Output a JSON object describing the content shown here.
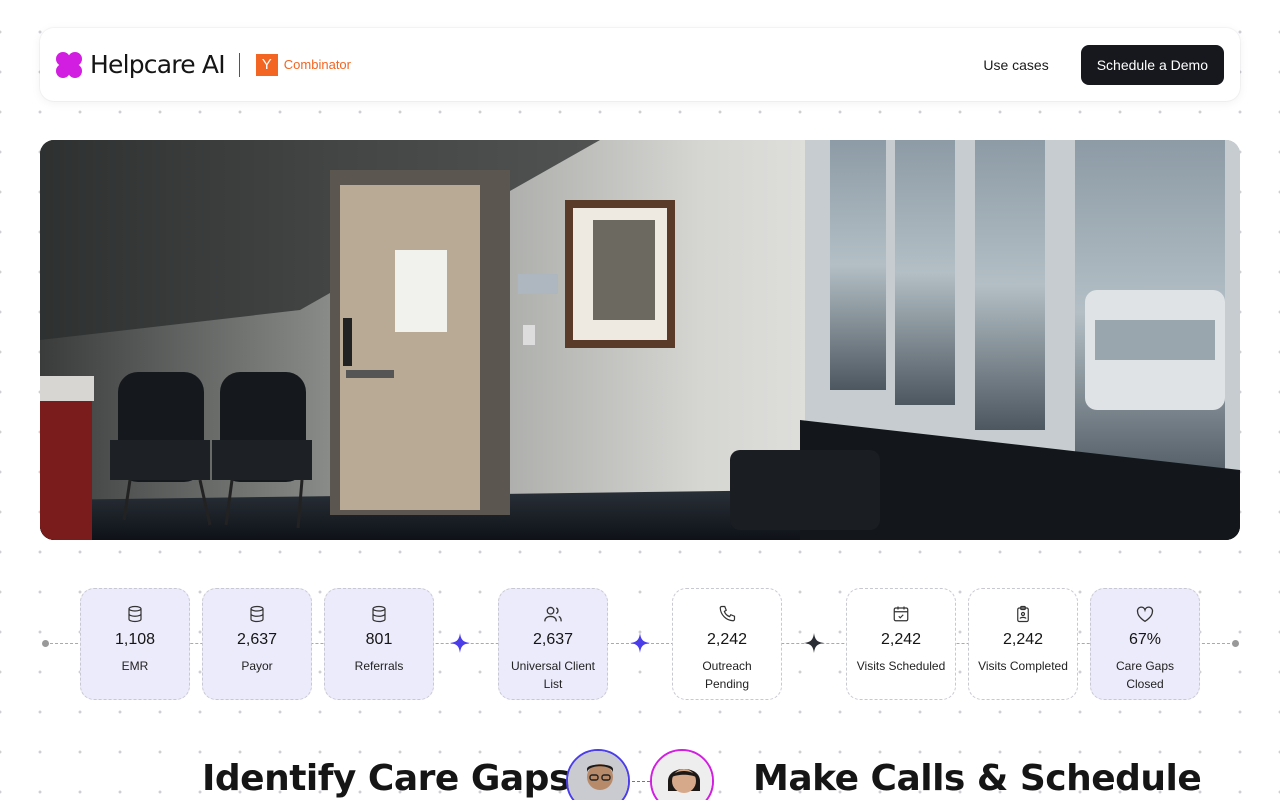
{
  "nav": {
    "brand": "Helpcare AI",
    "yc_letter": "Y",
    "yc_text": "Combinator",
    "link_use_cases": "Use cases",
    "cta": "Schedule a Demo"
  },
  "flow": [
    {
      "icon": "database-icon",
      "value": "1,108",
      "label": "EMR",
      "style": "filled"
    },
    {
      "icon": "database-icon",
      "value": "2,637",
      "label": "Payor",
      "style": "filled"
    },
    {
      "icon": "database-icon",
      "value": "801",
      "label": "Referrals",
      "style": "filled"
    },
    {
      "icon": "users-icon",
      "value": "2,637",
      "label": "Universal Client List",
      "style": "filled"
    },
    {
      "icon": "phone-icon",
      "value": "2,242",
      "label": "Outreach Pending",
      "style": "plain"
    },
    {
      "icon": "calendar-check-icon",
      "value": "2,242",
      "label": "Visits Scheduled",
      "style": "plain"
    },
    {
      "icon": "clipboard-icon",
      "value": "2,242",
      "label": "Visits Completed",
      "style": "plain"
    },
    {
      "icon": "heart-icon",
      "value": "67%",
      "label": "Care Gaps Closed",
      "style": "filled"
    }
  ],
  "sections": {
    "left_heading": "Identify Care Gaps",
    "right_heading": "Make Calls & Schedule"
  },
  "colors": {
    "brand_magenta": "#d11ee0",
    "yc_orange": "#f26522",
    "accent_violet": "#4b3ee8",
    "dark": "#16181d",
    "stat_fill": "#ecebfb"
  }
}
